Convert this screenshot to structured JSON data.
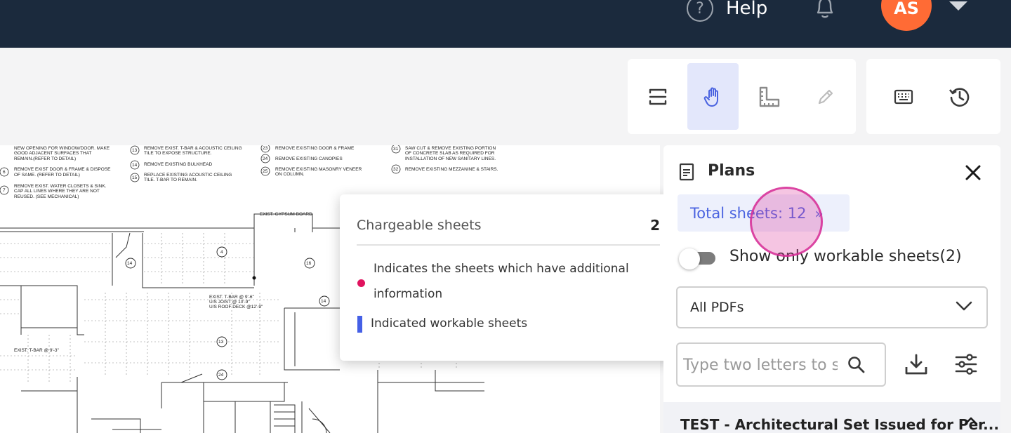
{
  "header": {
    "help_label": "Help",
    "help_glyph": "?",
    "avatar_initials": "AS",
    "avatar_color": "#ff6b35",
    "bar_color": "#1b2a3d"
  },
  "toolbar": {
    "group1": [
      "sheet-compare-icon",
      "hand-pan-icon",
      "measure-icon",
      "markup-pen-icon"
    ],
    "active_tool": "hand-pan-icon",
    "group2": [
      "keyboard-icon",
      "history-icon"
    ]
  },
  "drawing": {
    "notes": [
      [
        "NEW OPENING FOR WINDOW/DOOR. MAKE",
        "GOOD ADJACENT SURFACES THAT",
        "REMAIN.(REFER TO DETAIL)"
      ],
      [
        "REMOVE EXIST DOOR & FRAME & DISPOSE",
        "OF SAME.  (REFER TO DETAIL)"
      ],
      [
        "REMOVE EXIST. WATER CLOSETS & SINK.",
        "CAP ALL LINES WHERE THEY ARE NOT",
        "REUSED. (SEE MECHANICAL)"
      ],
      [
        "REMOVE EXIST. T-BAR & ACOUSTIC CEILING",
        "TILE TO EXPOSE STRUCTURE."
      ],
      [
        "REMOVE EXISTING BULKHEAD"
      ],
      [
        "REPLACE EXISTING ACOUSTIC CEILING",
        "TILE. T-BAR TO REMAIN."
      ],
      [
        "REMOVE EXISTING DOOR & FRAME"
      ],
      [
        "REMOVE EXISTING CANOPIES"
      ],
      [
        "REMOVE EXISTING MASONRY VENEER",
        "ON COLUMN."
      ],
      [
        "SAW CUT & REMOVE EXISTING PORTION",
        "OF CONCRETE SLAB AS REQUIRED FOR",
        "INSTALLATION OF NEW SANITARY LINES."
      ],
      [
        "REMOVE EXISTING MEZZANINE & STAIRS."
      ]
    ],
    "note_numbers": [
      "6",
      "7",
      "13",
      "14",
      "15",
      "23",
      "24",
      "25",
      "31",
      "32"
    ],
    "labels": {
      "gypsum": "EXIST. GYPSUM BOARD",
      "tbar_1": "EXIST. T-BAR @ 9'-6\"",
      "tbar_2": "U/S JOIST @ 10'-9\"",
      "tbar_3": "U/S ROOF DECK @12'-9\"",
      "tbar_left": "EXIST. T-BAR @ 9'-3\""
    },
    "tags": [
      "14",
      "4",
      "16",
      "14",
      "13",
      "24"
    ]
  },
  "legend_popover": {
    "title": "Chargeable sheets",
    "count": "2",
    "item1": "Indicates the sheets which have additional information",
    "item1_color": "#e0135e",
    "item2": "Indicated workable sheets",
    "item2_color": "#4560e6"
  },
  "plans_panel": {
    "title": "Plans",
    "total_sheets": "Total sheets: 12",
    "total_chevrons": "»",
    "toggle_label": "Show only workable sheets(2)",
    "toggle_on": false,
    "pdf_select_value": "All PDFs",
    "search_placeholder": "Type two letters to search",
    "section_title": "TEST - Architectural Set Issued for Per..."
  }
}
